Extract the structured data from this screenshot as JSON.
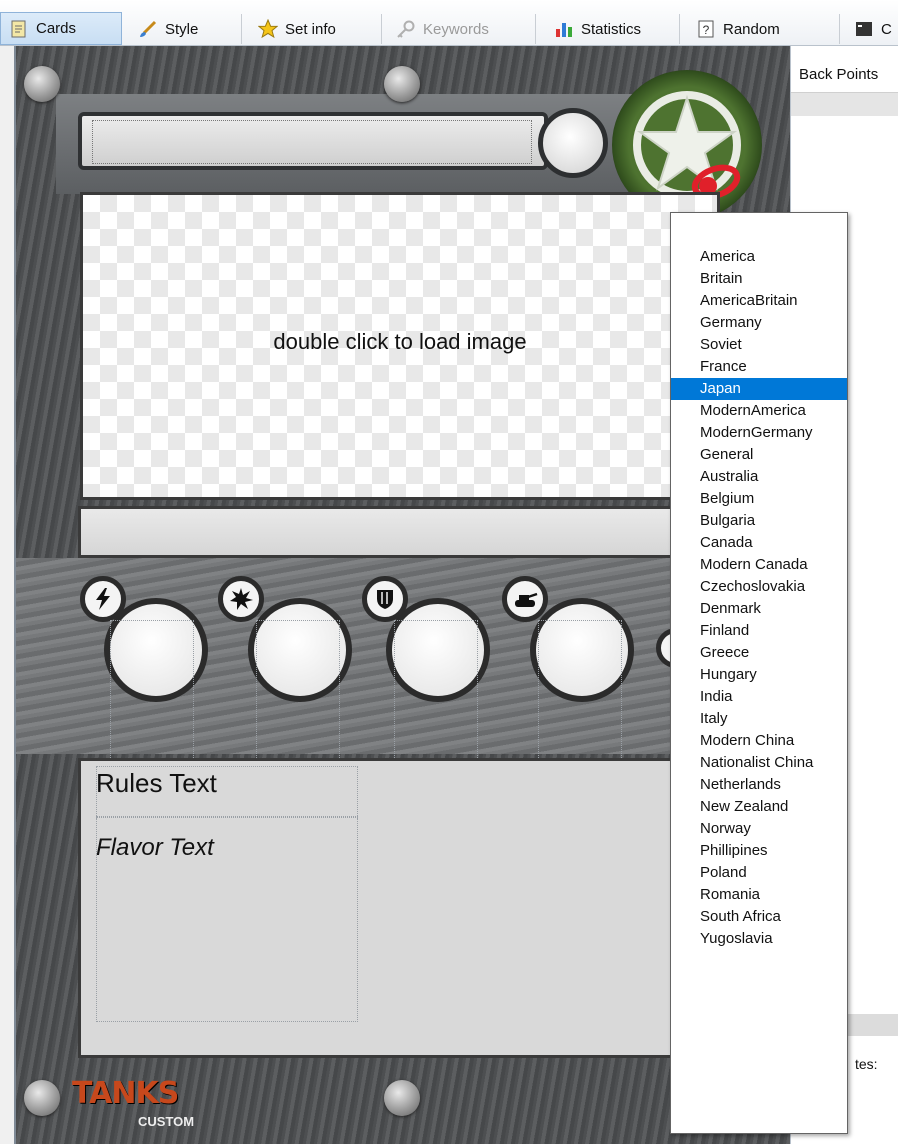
{
  "toolbar": {
    "tabs": [
      {
        "label": "Cards",
        "icon": "cards-icon"
      },
      {
        "label": "Style",
        "icon": "brush-icon"
      },
      {
        "label": "Set info",
        "icon": "star-icon"
      },
      {
        "label": "Keywords",
        "icon": "key-icon"
      },
      {
        "label": "Statistics",
        "icon": "bar-chart-icon"
      },
      {
        "label": "Random",
        "icon": "question-icon"
      },
      {
        "label": "C",
        "icon": "console-icon"
      }
    ]
  },
  "card": {
    "image_placeholder": "double click to load image",
    "rules_text": "Rules Text",
    "flavor_text": "Flavor Text",
    "logo_text": "TANKS",
    "logo_sub": "CUSTOM"
  },
  "panel": {
    "header": "Back Points",
    "notes_label": "tes:"
  },
  "dropdown": {
    "selected": "Japan",
    "options": [
      "America",
      "Britain",
      "AmericaBritain",
      "Germany",
      "Soviet",
      "France",
      "Japan",
      "ModernAmerica",
      "ModernGermany",
      "General",
      "Australia",
      "Belgium",
      "Bulgaria",
      "Canada",
      "Modern Canada",
      "Czechoslovakia",
      "Denmark",
      "Finland",
      "Greece",
      "Hungary",
      "India",
      "Italy",
      "Modern China",
      "Nationalist China",
      "Netherlands",
      "New Zealand",
      "Norway",
      "Phillipines",
      "Poland",
      "Romania",
      "South Africa",
      "Yugoslavia"
    ]
  },
  "colors": {
    "selection": "#0078d7",
    "emblem_green": "#4e7330",
    "highlight_red": "#e0202a"
  }
}
